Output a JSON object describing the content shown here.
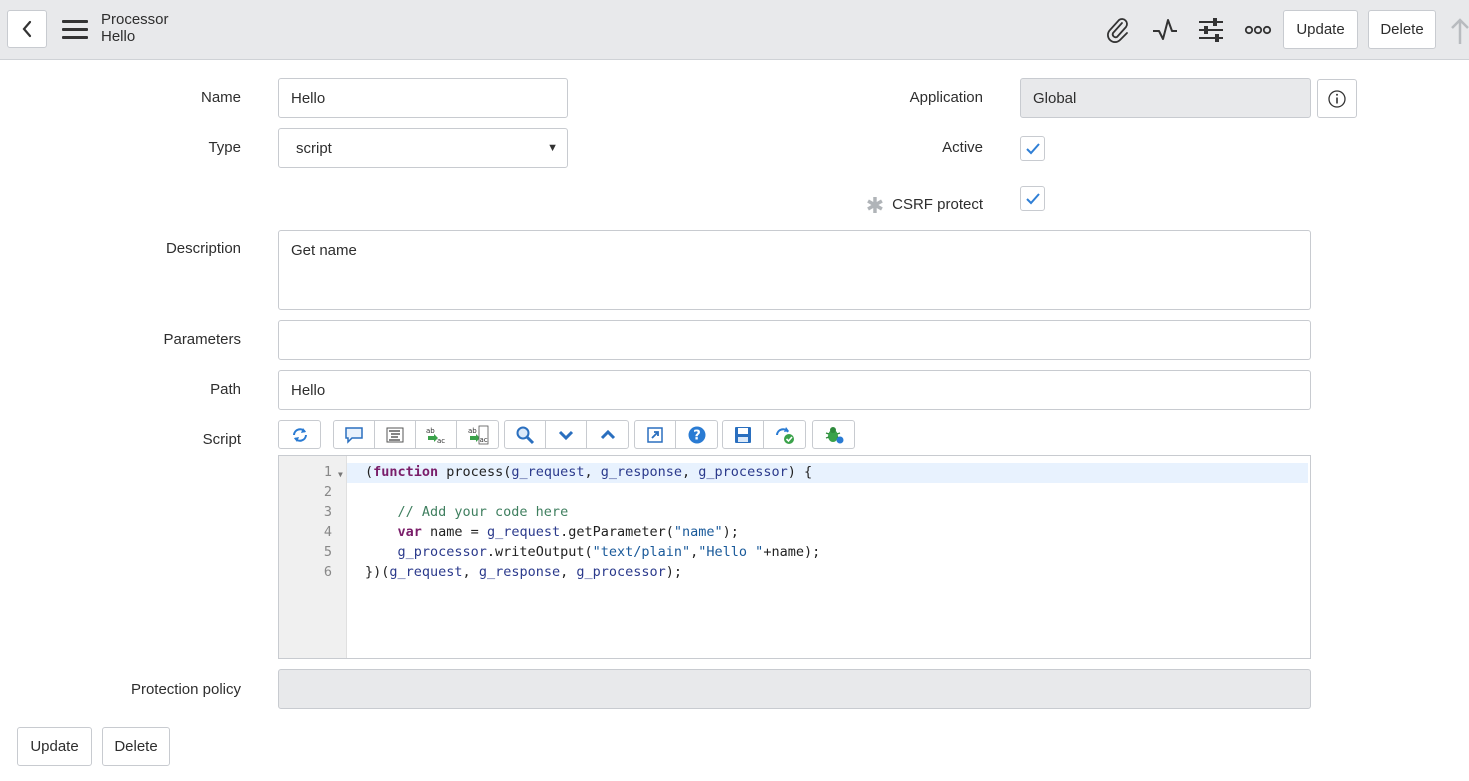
{
  "header": {
    "title": "Processor",
    "subtitle": "Hello",
    "update_label": "Update",
    "delete_label": "Delete"
  },
  "form": {
    "name": {
      "label": "Name",
      "value": "Hello"
    },
    "type": {
      "label": "Type",
      "value": "script"
    },
    "application": {
      "label": "Application",
      "value": "Global"
    },
    "active": {
      "label": "Active",
      "checked": true
    },
    "csrf": {
      "label": "CSRF protect",
      "checked": true
    },
    "description": {
      "label": "Description",
      "value": "Get name"
    },
    "parameters": {
      "label": "Parameters",
      "value": ""
    },
    "path": {
      "label": "Path",
      "value": "Hello"
    },
    "script": {
      "label": "Script"
    },
    "protection_policy": {
      "label": "Protection policy",
      "value": ""
    }
  },
  "script_lines": [
    {
      "n": "1",
      "text": "(function process(g_request, g_response, g_processor) {"
    },
    {
      "n": "2",
      "text": ""
    },
    {
      "n": "3",
      "text": "    // Add your code here"
    },
    {
      "n": "4",
      "text": "    var name = g_request.getParameter(\"name\");"
    },
    {
      "n": "5",
      "text": "    g_processor.writeOutput(\"text/plain\",\"Hello \"+name);"
    },
    {
      "n": "6",
      "text": "})(g_request, g_response, g_processor);"
    }
  ],
  "footer": {
    "update_label": "Update",
    "delete_label": "Delete"
  },
  "colors": {
    "header_bg": "#e8e9eb",
    "checkbox_check": "#2f7fd6",
    "keyword": "#7a1e6a",
    "comment": "#3f7f5f"
  }
}
